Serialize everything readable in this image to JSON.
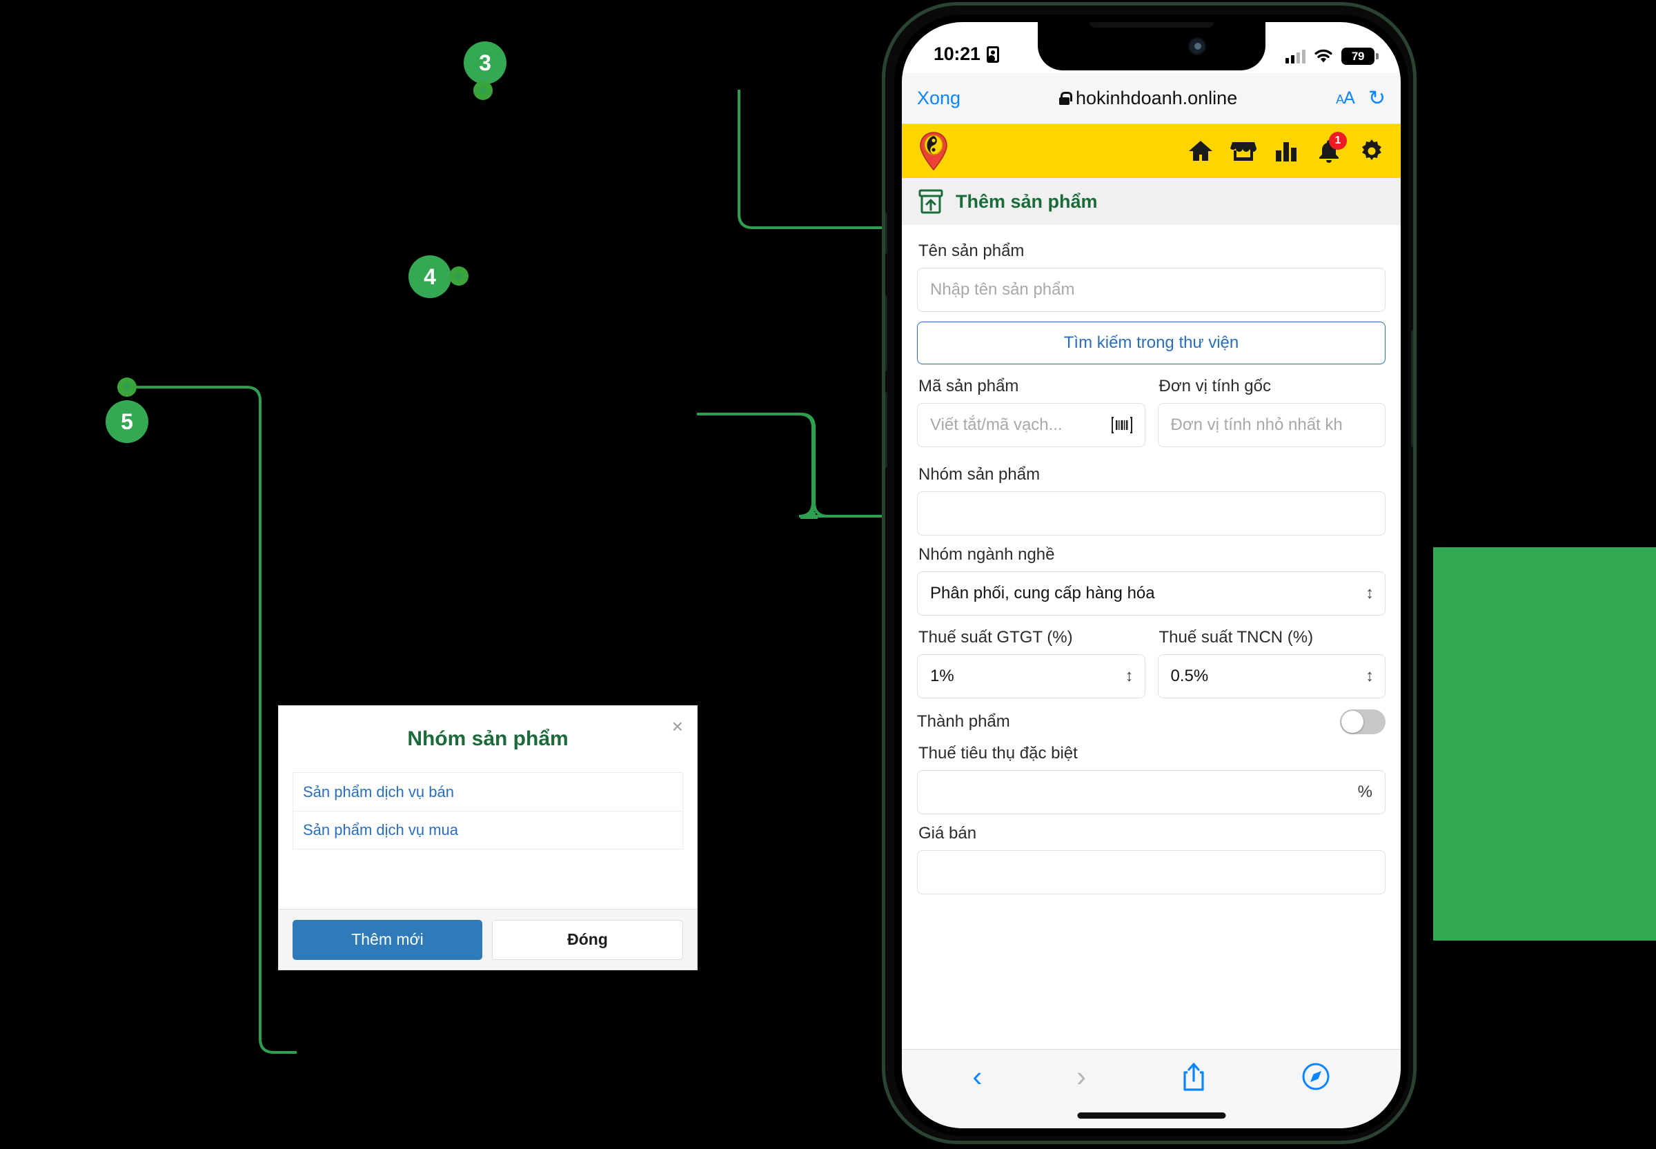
{
  "colors": {
    "accent_green": "#34a853",
    "brand_yellow": "#ffd500",
    "title_green": "#1b6b3a",
    "link_blue": "#2a6ebb",
    "ios_blue": "#0a84ff",
    "badge_red": "#ed1c24",
    "block_green": "#33a852"
  },
  "annotations": [
    {
      "number": "3"
    },
    {
      "number": "4"
    },
    {
      "number": "5"
    }
  ],
  "phone": {
    "status_bar": {
      "time": "10:21",
      "id_icon": "id-card-icon",
      "signal_icon": "cellular-signal-icon",
      "wifi_icon": "wifi-icon",
      "battery_level": "79"
    },
    "browser": {
      "done_label": "Xong",
      "lock_icon": "lock-icon",
      "url": "hokinhdoanh.online",
      "text_size_label": "A",
      "text_size_label_big": "A",
      "reload_icon": "reload-icon",
      "bottom": {
        "back_icon": "chevron-left-icon",
        "forward_icon": "chevron-right-icon",
        "share_icon": "share-icon",
        "tabs_icon": "compass-icon"
      }
    },
    "appbar": {
      "logo_icon": "map-pin-logo-icon",
      "icons": [
        {
          "name": "home-icon"
        },
        {
          "name": "store-icon"
        },
        {
          "name": "chart-bar-icon"
        },
        {
          "name": "bell-icon",
          "badge": "1"
        },
        {
          "name": "gear-icon"
        }
      ]
    },
    "page": {
      "title_icon": "box-upload-icon",
      "title": "Thêm sản phẩm"
    },
    "form": {
      "product_name_label": "Tên sản phẩm",
      "product_name_placeholder": "Nhập tên sản phẩm",
      "search_library_button": "Tìm kiếm trong thư viện",
      "product_code_label": "Mã sản phẩm",
      "product_code_placeholder": "Viết tắt/mã vạch...",
      "barcode_icon": "barcode-scan-icon",
      "base_unit_label": "Đơn vị tính gốc",
      "base_unit_placeholder": "Đơn vị tính nhỏ nhất kh",
      "product_group_label": "Nhóm sản phẩm",
      "product_group_value": "",
      "industry_group_label": "Nhóm ngành nghề",
      "industry_group_value": "Phân phối, cung cấp hàng hóa",
      "vat_label": "Thuế suất GTGT (%)",
      "vat_value": "1%",
      "pit_label": "Thuế suất TNCN (%)",
      "pit_value": "0.5%",
      "finished_goods_label": "Thành phẩm",
      "finished_goods_state": "off",
      "excise_tax_label": "Thuế tiêu thụ đặc biệt",
      "excise_tax_value": "",
      "excise_tax_suffix": "%",
      "selling_price_label": "Giá bán"
    }
  },
  "modal": {
    "title": "Nhóm sản phẩm",
    "close_icon": "close-icon",
    "items": [
      {
        "label": "Sản phẩm dịch vụ bán"
      },
      {
        "label": "Sản phẩm dịch vụ mua"
      }
    ],
    "primary_button": "Thêm mới",
    "secondary_button": "Đóng"
  }
}
